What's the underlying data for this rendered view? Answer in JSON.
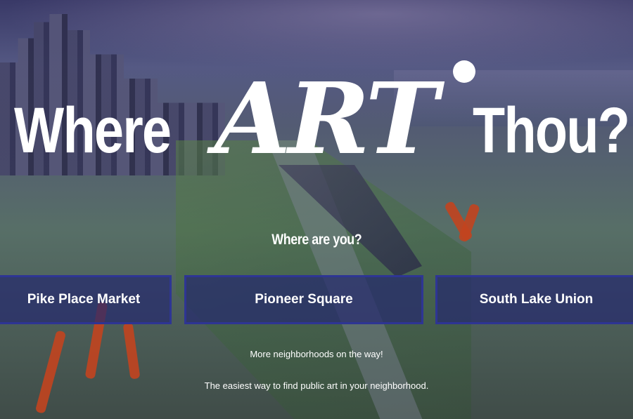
{
  "hero": {
    "title_where": "Where",
    "title_art": "ART",
    "title_thou": "Thou?"
  },
  "prompt": "Where are you?",
  "neighborhoods": [
    {
      "label": "Pike Place Market"
    },
    {
      "label": "Pioneer Square"
    },
    {
      "label": "South Lake Union"
    }
  ],
  "colors": {
    "button_border": "#2e3594",
    "button_fill": "#262a6e",
    "text": "#ffffff",
    "sculpture": "#c2441f"
  },
  "more_text": "More neighborhoods on the way!",
  "tagline": "The easiest way to find public art in your neighborhood."
}
